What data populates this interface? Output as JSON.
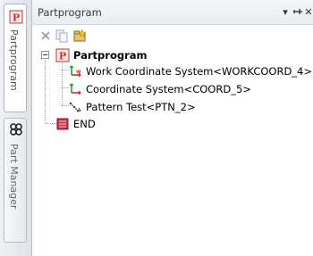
{
  "panel": {
    "title": "Partprogram",
    "controls": {
      "menu": "▾",
      "pin": "⊣",
      "close": "✕"
    }
  },
  "tabs": [
    {
      "label": "Partprogram",
      "icon": "partprogram-p-icon"
    },
    {
      "label": "Part Manager",
      "icon": "part-manager-icon"
    }
  ],
  "toolbar": [
    {
      "icon": "delete-icon"
    },
    {
      "icon": "copy-icon"
    },
    {
      "icon": "new-item-icon"
    }
  ],
  "tree": {
    "root": {
      "label": "Partprogram",
      "icon": "partprogram-p-icon"
    },
    "children": [
      {
        "label": "Work Coordinate System<WORKCOORD_4>",
        "icon": "work-coordinate-system-icon"
      },
      {
        "label": "Coordinate System<COORD_5>",
        "icon": "coordinate-system-icon"
      },
      {
        "label": "Pattern Test<PTN_2>",
        "icon": "pattern-icon"
      }
    ],
    "end": {
      "label": "END",
      "icon": "end-icon"
    }
  },
  "colors": {
    "accent_red": "#d22b2b",
    "accent_green": "#2b9a3a",
    "tab_border": "#b5bcc6"
  }
}
